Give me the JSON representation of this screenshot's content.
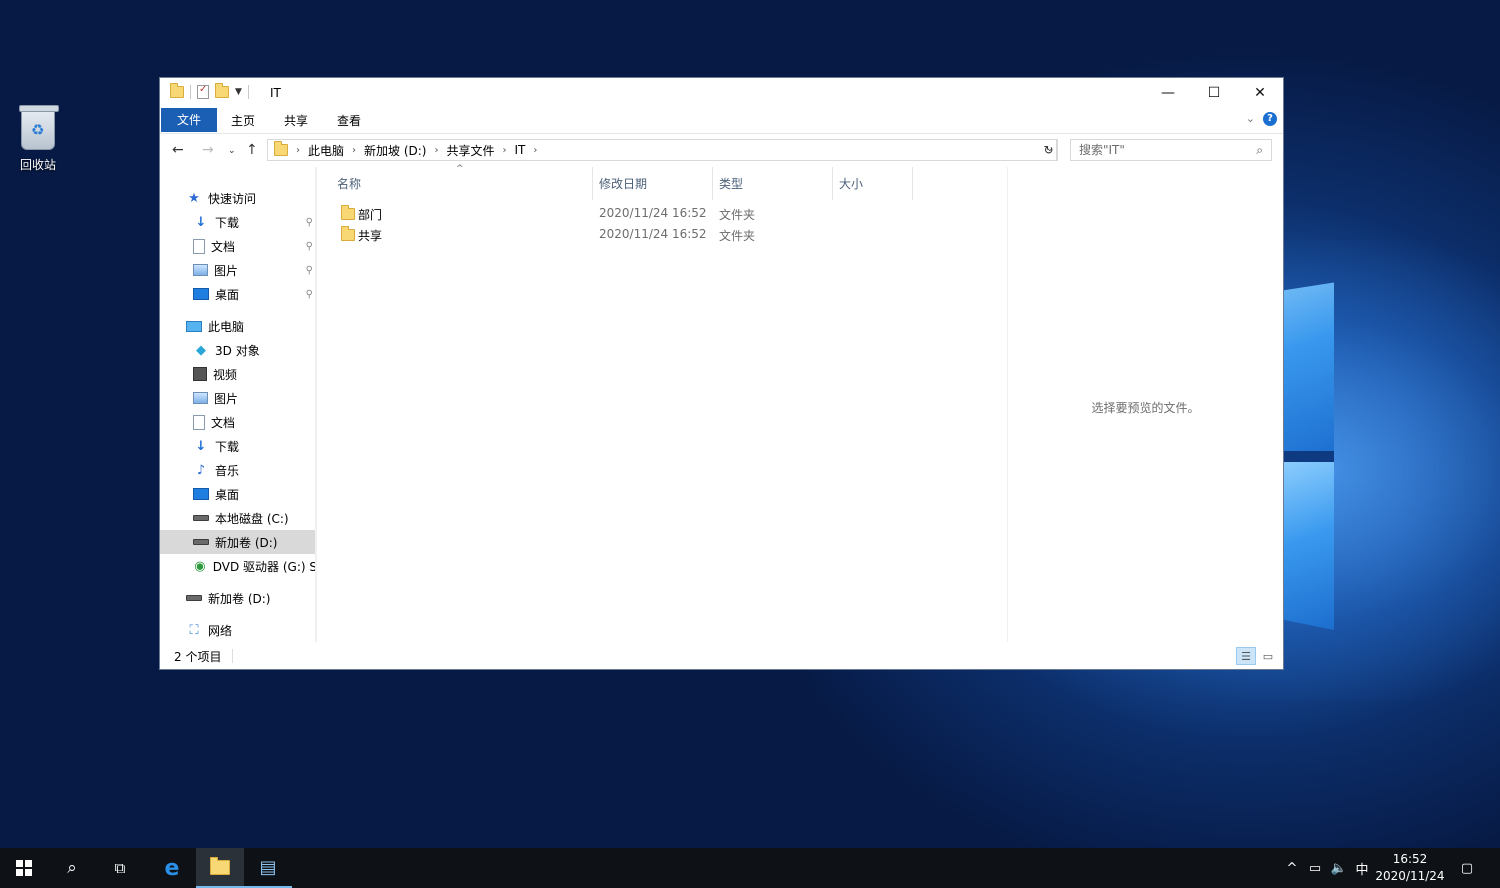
{
  "desktop": {
    "recycle_bin_label": "回收站"
  },
  "window": {
    "title": "IT",
    "controls": {
      "minimize": "—",
      "maximize": "☐",
      "close": "✕"
    }
  },
  "ribbon": {
    "tabs": [
      {
        "label": "文件"
      },
      {
        "label": "主页"
      },
      {
        "label": "共享"
      },
      {
        "label": "查看"
      }
    ]
  },
  "address": {
    "breadcrumbs": [
      "此电脑",
      "新加坡 (D:)",
      "共享文件",
      "IT"
    ]
  },
  "search": {
    "placeholder": "搜索\"IT\""
  },
  "nav": {
    "quick_access": "快速访问",
    "quick_items": [
      "下载",
      "文档",
      "图片",
      "桌面"
    ],
    "this_pc": "此电脑",
    "pc_items": [
      "3D 对象",
      "视频",
      "图片",
      "文档",
      "下载",
      "音乐",
      "桌面",
      "本地磁盘 (C:)",
      "新加卷 (D:)",
      "DVD 驱动器 (G:) S"
    ],
    "drive_d": "新加卷 (D:)",
    "network": "网络"
  },
  "columns": {
    "name": "名称",
    "date": "修改日期",
    "type": "类型",
    "size": "大小"
  },
  "files": [
    {
      "name": "部门",
      "date": "2020/11/24 16:52",
      "type": "文件夹"
    },
    {
      "name": "共享",
      "date": "2020/11/24 16:52",
      "type": "文件夹"
    }
  ],
  "preview": {
    "message": "选择要预览的文件。"
  },
  "status": {
    "count": "2 个项目"
  },
  "taskbar": {
    "ime": "中",
    "time": "16:52",
    "date": "2020/11/24"
  },
  "colors": {
    "accent": "#1a5fb4",
    "taskbar": "#0e1217",
    "folder": "#f8d775"
  }
}
